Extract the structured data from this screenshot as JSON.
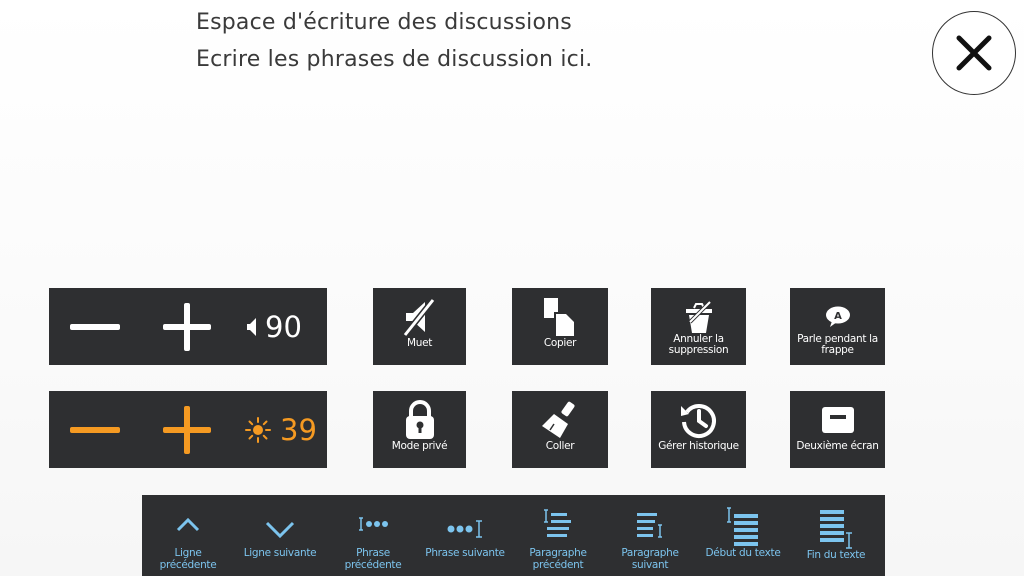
{
  "header": {
    "title": "Espace d'écriture des discussions",
    "placeholder": "Ecrire les phrases de discussion ici."
  },
  "close": {
    "icon": "close-icon"
  },
  "volume": {
    "value": "90",
    "icon": "speaker-icon"
  },
  "brightness": {
    "value": "39",
    "icon": "sun-icon",
    "color": "#f59a22"
  },
  "tiles": {
    "mute": "Muet",
    "copy": "Copier",
    "undo_delete": "Annuler la suppression",
    "speak_while_typing": "Parle pendant la frappe",
    "private_mode": "Mode privé",
    "paste": "Coller",
    "history": "Gérer historique",
    "second_screen": "Deuxième écran"
  },
  "nav": {
    "prev_line": "Ligne précédente",
    "next_line": "Ligne suivante",
    "prev_sentence": "Phrase précédente",
    "next_sentence": "Phrase suivante",
    "prev_paragraph": "Paragraphe précédent",
    "next_paragraph": "Paragraphe suivant",
    "text_start": "Début du texte",
    "text_end": "Fin du texte"
  },
  "colors": {
    "panel": "#2e2f31",
    "accent_orange": "#f59a22",
    "nav_blue": "#7cc4ee"
  }
}
